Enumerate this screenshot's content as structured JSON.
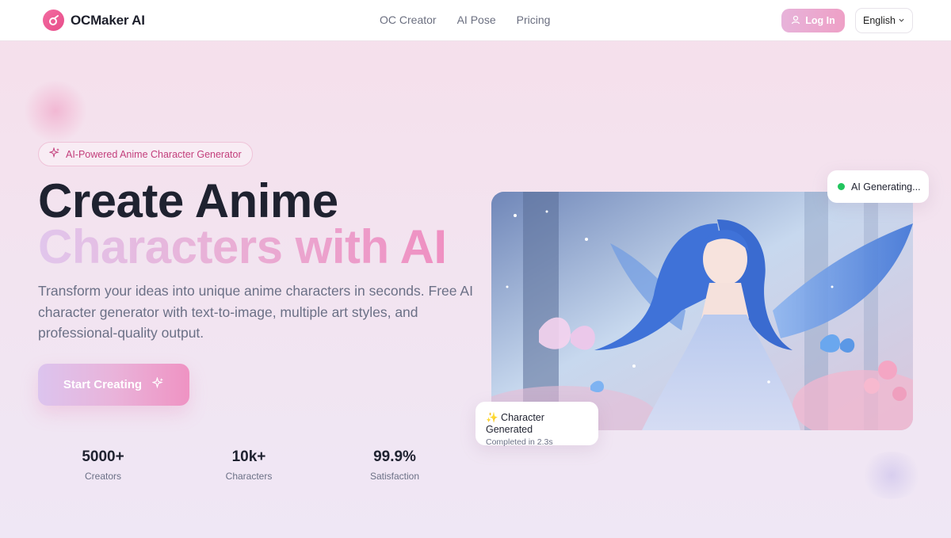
{
  "brand": {
    "name": "OCMaker AI",
    "logo_icon": "logo-icon",
    "accent": "#e84d8a"
  },
  "nav": {
    "links": [
      "OC Creator",
      "AI Pose",
      "Pricing"
    ],
    "login_label": "Log In",
    "language": "English"
  },
  "hero": {
    "badge": "AI-Powered Anime Character Generator",
    "title_line1": "Create Anime",
    "title_line2": "Characters with AI",
    "description": "Transform your ideas into unique anime characters in seconds. Free AI character generator with text-to-image, multiple art styles, and professional-quality output.",
    "cta_label": "Start Creating",
    "stats": [
      {
        "value": "5000+",
        "label": "Creators"
      },
      {
        "value": "10k+",
        "label": "Characters"
      },
      {
        "value": "99.9%",
        "label": "Satisfaction"
      }
    ]
  },
  "preview": {
    "status_label": "AI Generating...",
    "status_color": "#22c55e",
    "result_title": "✨ Character Generated",
    "result_subtitle": "Completed in 2.3s"
  }
}
